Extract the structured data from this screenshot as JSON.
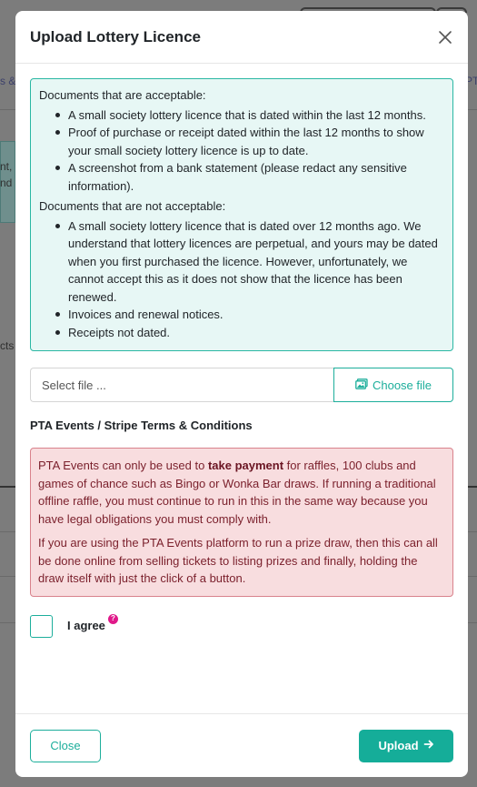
{
  "background": {
    "fragment_left_a": "s &",
    "fragment_left_b1": "nt,",
    "fragment_left_b2": "nd",
    "fragment_left_c": "cts",
    "fragment_right_a": "PT"
  },
  "modal": {
    "title": "Upload Lottery Licence",
    "close_icon": "close-icon",
    "info": {
      "acceptable_heading": "Documents that are acceptable:",
      "acceptable": [
        "A small society lottery licence that is dated within the last 12 months.",
        "Proof of purchase or receipt dated within the last 12 months to show your small society lottery licence is up to date.",
        "A screenshot from a bank statement (please redact any sensitive information)."
      ],
      "not_acceptable_heading": "Documents that are not acceptable:",
      "not_acceptable": [
        "A small society lottery licence that is dated over 12 months ago. We understand that lottery licences are perpetual, and yours may be dated when you first purchased the licence. However, unfortunately, we cannot accept this as it does not show that the licence has been renewed.",
        "Invoices and renewal notices.",
        "Receipts not dated."
      ]
    },
    "file": {
      "placeholder": "Select file ...",
      "choose_label": "Choose file",
      "choose_icon": "image-icon"
    },
    "terms": {
      "title": "PTA Events / Stripe Terms & Conditions",
      "para1_prefix": "PTA Events can only be used to ",
      "para1_bold": "take payment",
      "para1_suffix": " for raffles, 100 clubs and games of chance such as Bingo or Wonka Bar draws. If running a traditional offline raffle, you must continue to run in this in the same way because you have legal obligations you must comply with.",
      "para2": "If you are using the PTA Events platform to run a prize draw, then this can all be done online from selling tickets to listing prizes and finally, holding the draw itself with just the click of a button."
    },
    "agree": {
      "label": "I agree",
      "checked": false,
      "help_badge": "?"
    },
    "footer": {
      "close_label": "Close",
      "upload_label": "Upload",
      "upload_icon": "arrow-right-icon"
    }
  },
  "colors": {
    "accent": "#15ad99",
    "info_bg": "#e7f7f5",
    "alert_bg": "#f8dddf",
    "alert_text": "#7a1f2b",
    "badge": "#e0198a"
  }
}
